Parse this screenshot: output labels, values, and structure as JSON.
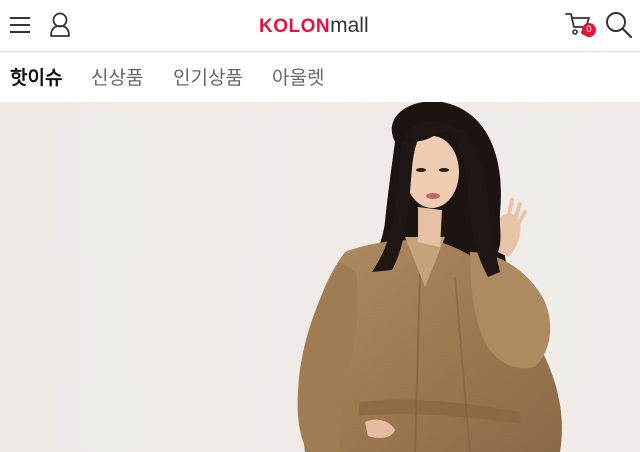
{
  "header": {
    "logo_primary": "KOLON",
    "logo_secondary": "mall",
    "cart_count": "0",
    "icons": [
      "menu-icon",
      "user-icon",
      "cart-icon",
      "search-icon"
    ]
  },
  "tabs": [
    {
      "label": "핫이슈",
      "active": true
    },
    {
      "label": "신상품",
      "active": false
    },
    {
      "label": "인기상품",
      "active": false
    },
    {
      "label": "아울렛",
      "active": false
    }
  ],
  "colors": {
    "brand_red": "#e5143b",
    "hero_background": "#efeae6",
    "trench_coat": "#a6825a",
    "hair": "#1b1411"
  }
}
